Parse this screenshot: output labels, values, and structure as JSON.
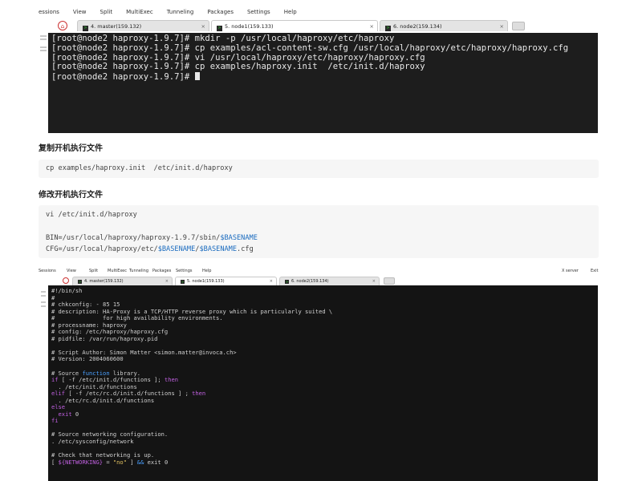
{
  "top_screenshot": {
    "menu": [
      "essions",
      "View",
      "Split",
      "MultiExec",
      "Tunneling",
      "Packages",
      "Settings",
      "Help"
    ],
    "tabs": [
      {
        "label": "4. master(159.132)",
        "active": false
      },
      {
        "label": "5. node1(159.133)",
        "active": true
      },
      {
        "label": "6. node2(159.134)",
        "active": false
      }
    ],
    "terminal_lines": [
      "[root@node2 haproxy-1.9.7]# mkdir -p /usr/local/haproxy/etc/haproxy",
      "[root@node2 haproxy-1.9.7]# cp examples/acl-content-sw.cfg /usr/local/haproxy/etc/haproxy/haproxy.cfg",
      "[root@node2 haproxy-1.9.7]# vi /usr/local/haproxy/etc/haproxy/haproxy.cfg",
      "[root@node2 haproxy-1.9.7]# cp examples/haproxy.init  /etc/init.d/haproxy",
      "[root@node2 haproxy-1.9.7]# "
    ]
  },
  "article": {
    "heading1": "复制开机执行文件",
    "code1": "cp examples/haproxy.init  /etc/init.d/haproxy",
    "heading2": "修改开机执行文件",
    "code2_line1": "vi /etc/init.d/haproxy",
    "code2_bin_prefix": "BIN=/usr/local/haproxy/haproxy-1.9.7/sbin/",
    "code2_bin_var": "$BASENAME",
    "code2_cfg_prefix": "CFG=/usr/local/haproxy/etc/",
    "code2_cfg_var": "$BASENAME",
    "code2_cfg_sep": "/",
    "code2_cfg_var2": "$BASENAME",
    "code2_cfg_suffix": ".cfg"
  },
  "bottom_screenshot": {
    "menu": [
      "Sessions",
      "View",
      "Split",
      "MultiExec",
      "Tunneling",
      "Packages",
      "Settings",
      "Help",
      "X server",
      "Exit"
    ],
    "tabs": [
      {
        "label": "4. master(159.132)",
        "active": false
      },
      {
        "label": "5. node1(159.133)",
        "active": true
      },
      {
        "label": "6. node2(159.134)",
        "active": false
      }
    ],
    "terminal": {
      "l1": "#!/bin/sh",
      "l2": "#",
      "l3": "# chkconfig: - 85 15",
      "l4": "# description: HA-Proxy is a TCP/HTTP reverse proxy which is particularly suited \\",
      "l5": "#              for high availability environments.",
      "l6": "# processname: haproxy",
      "l7": "# config: /etc/haproxy/haproxy.cfg",
      "l8": "# pidfile: /var/run/haproxy.pid",
      "l9": "",
      "l10": "# Script Author: Simon Matter <simon.matter@invoca.ch>",
      "l11": "# Version: 2004060600",
      "l12": "",
      "l13_pre": "# Source ",
      "l13_fn": "function",
      "l13_post": " library.",
      "l14_kw": "if",
      "l14_mid": " [ -f /etc/init.d/functions ]; ",
      "l14_kw2": "then",
      "l15": "  . /etc/init.d/functions",
      "l16_kw": "elif",
      "l16_mid": " [ -f /etc/rc.d/init.d/functions ] ; ",
      "l16_kw2": "then",
      "l17": "  . /etc/rc.d/init.d/functions",
      "l18_kw": "else",
      "l19_kw": "  exit",
      "l19_post": " 0",
      "l20_kw": "fi",
      "l21": "",
      "l22": "# Source networking configuration.",
      "l23": ". /etc/sysconfig/network",
      "l24": "",
      "l25": "# Check that networking is up.",
      "l26_pre": "[ ",
      "l26_var": "${NETWORKING}",
      "l26_mid": " = ",
      "l26_str": "\"no\"",
      "l26_post": " ] ",
      "l26_op": "&&",
      "l26_end": " exit 0"
    }
  }
}
